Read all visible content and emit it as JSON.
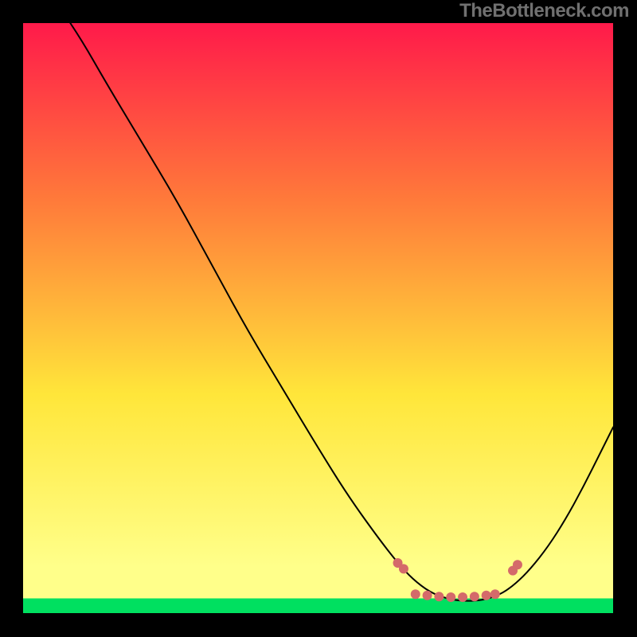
{
  "watermark": "TheBottleneck.com",
  "chart_data": {
    "type": "line",
    "title": "",
    "xlabel": "",
    "ylabel": "",
    "xlim": [
      0,
      1
    ],
    "ylim": [
      0,
      1
    ],
    "background_gradient": {
      "top_color": "#ff1a4a",
      "upper_mid_color": "#ff7a3a",
      "mid_color": "#ffe63a",
      "lower_color": "#ffff8a",
      "lowest_band_color": "#00e060"
    },
    "main_curve": {
      "color": "#000000",
      "width": 2,
      "points": [
        {
          "x": 0.08,
          "y": 1.0
        },
        {
          "x": 0.1,
          "y": 0.97
        },
        {
          "x": 0.14,
          "y": 0.9
        },
        {
          "x": 0.2,
          "y": 0.8
        },
        {
          "x": 0.26,
          "y": 0.7
        },
        {
          "x": 0.32,
          "y": 0.59
        },
        {
          "x": 0.38,
          "y": 0.48
        },
        {
          "x": 0.44,
          "y": 0.38
        },
        {
          "x": 0.5,
          "y": 0.28
        },
        {
          "x": 0.55,
          "y": 0.2
        },
        {
          "x": 0.6,
          "y": 0.13
        },
        {
          "x": 0.635,
          "y": 0.085
        },
        {
          "x": 0.66,
          "y": 0.058
        },
        {
          "x": 0.69,
          "y": 0.035
        },
        {
          "x": 0.72,
          "y": 0.024
        },
        {
          "x": 0.75,
          "y": 0.02
        },
        {
          "x": 0.78,
          "y": 0.022
        },
        {
          "x": 0.81,
          "y": 0.032
        },
        {
          "x": 0.835,
          "y": 0.05
        },
        {
          "x": 0.86,
          "y": 0.075
        },
        {
          "x": 0.89,
          "y": 0.113
        },
        {
          "x": 0.92,
          "y": 0.16
        },
        {
          "x": 0.95,
          "y": 0.215
        },
        {
          "x": 0.98,
          "y": 0.275
        },
        {
          "x": 1.0,
          "y": 0.315
        }
      ]
    },
    "marker_clusters": {
      "color": "#d46a6a",
      "radius": 6,
      "points": [
        {
          "x": 0.635,
          "y": 0.085
        },
        {
          "x": 0.645,
          "y": 0.075
        },
        {
          "x": 0.665,
          "y": 0.032
        },
        {
          "x": 0.685,
          "y": 0.03
        },
        {
          "x": 0.705,
          "y": 0.028
        },
        {
          "x": 0.725,
          "y": 0.027
        },
        {
          "x": 0.745,
          "y": 0.027
        },
        {
          "x": 0.765,
          "y": 0.028
        },
        {
          "x": 0.785,
          "y": 0.03
        },
        {
          "x": 0.8,
          "y": 0.032
        },
        {
          "x": 0.83,
          "y": 0.072
        },
        {
          "x": 0.838,
          "y": 0.082
        }
      ]
    }
  }
}
